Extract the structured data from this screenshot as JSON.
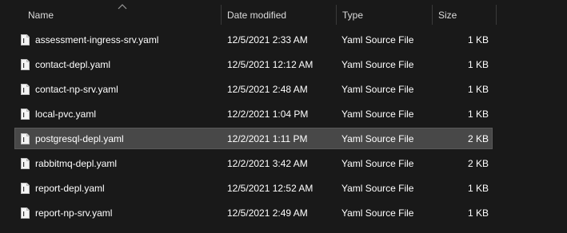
{
  "columns": {
    "name": "Name",
    "date_modified": "Date modified",
    "type": "Type",
    "size": "Size"
  },
  "sort": {
    "column": "name",
    "direction": "ascending",
    "icon": "sort-up-caret-icon"
  },
  "file_icon": "yaml-file-icon",
  "selected_row": 4,
  "files": [
    {
      "name": "assessment-ingress-srv.yaml",
      "date": "12/5/2021 2:33 AM",
      "type": "Yaml Source File",
      "size": "1 KB"
    },
    {
      "name": "contact-depl.yaml",
      "date": "12/5/2021 12:12 AM",
      "type": "Yaml Source File",
      "size": "1 KB"
    },
    {
      "name": "contact-np-srv.yaml",
      "date": "12/5/2021 2:48 AM",
      "type": "Yaml Source File",
      "size": "1 KB"
    },
    {
      "name": "local-pvc.yaml",
      "date": "12/2/2021 1:04 PM",
      "type": "Yaml Source File",
      "size": "1 KB"
    },
    {
      "name": "postgresql-depl.yaml",
      "date": "12/2/2021 1:11 PM",
      "type": "Yaml Source File",
      "size": "2 KB"
    },
    {
      "name": "rabbitmq-depl.yaml",
      "date": "12/2/2021 3:42 AM",
      "type": "Yaml Source File",
      "size": "2 KB"
    },
    {
      "name": "report-depl.yaml",
      "date": "12/5/2021 12:52 AM",
      "type": "Yaml Source File",
      "size": "1 KB"
    },
    {
      "name": "report-np-srv.yaml",
      "date": "12/5/2021 2:49 AM",
      "type": "Yaml Source File",
      "size": "1 KB"
    }
  ],
  "colors": {
    "background": "#191919",
    "selected_row": "#484848",
    "text": "#ffffff"
  }
}
